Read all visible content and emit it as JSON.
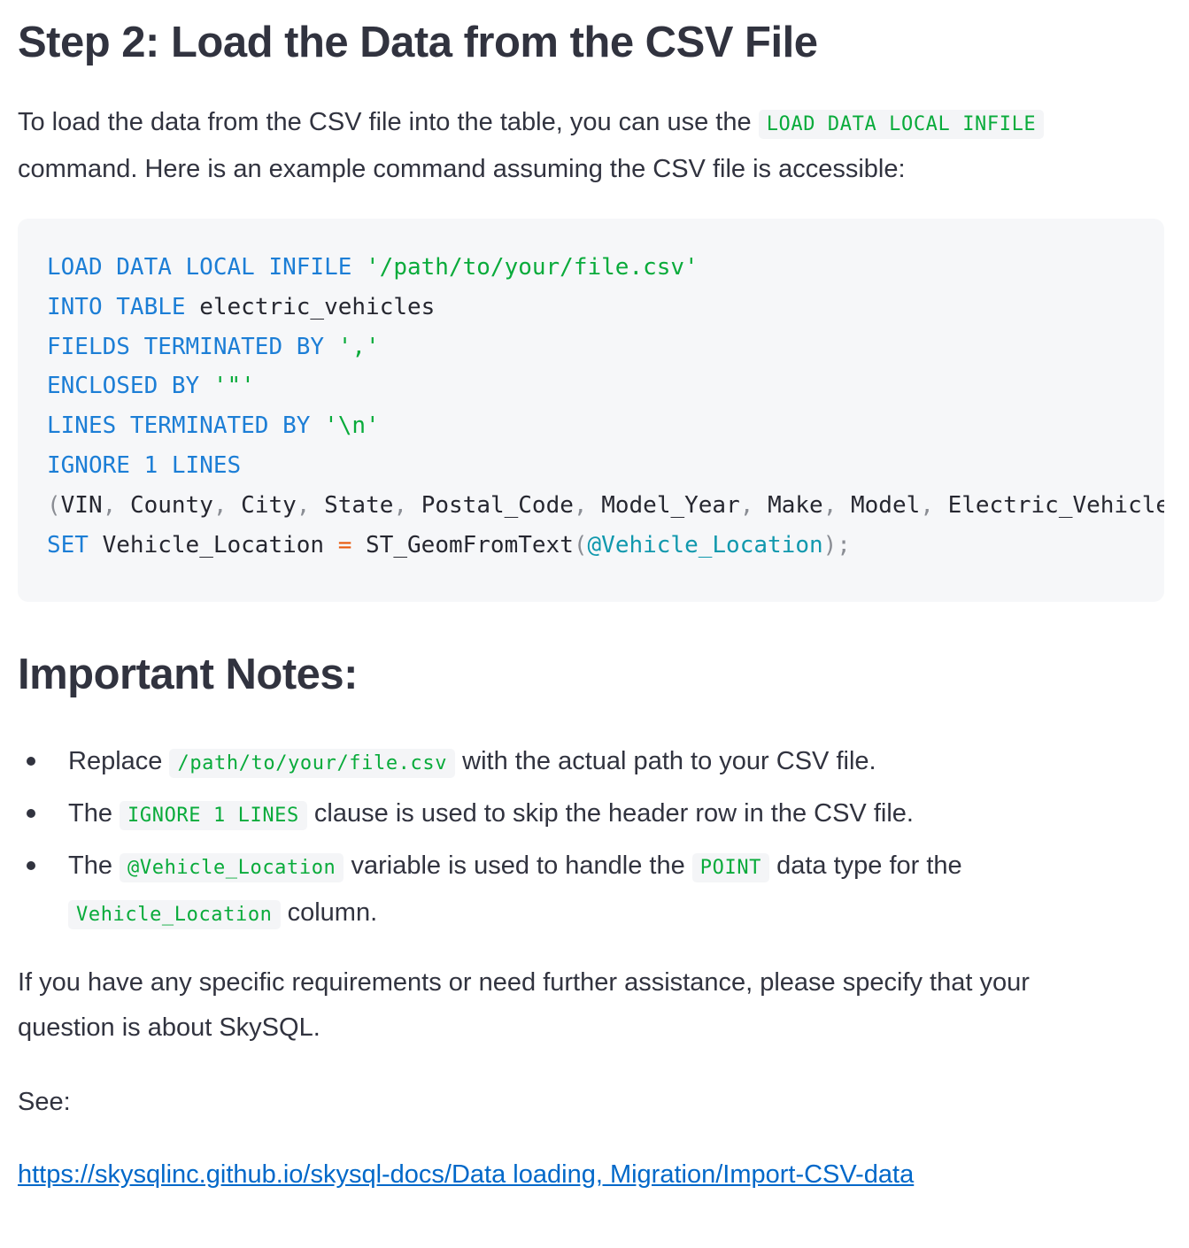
{
  "step_title": "Step 2: Load the Data from the CSV File",
  "intro": {
    "before": "To load the data from the CSV file into the table, you can use the ",
    "code": "LOAD DATA LOCAL INFILE",
    "after": " command. Here is an example command assuming the CSV file is accessible:"
  },
  "code_block": {
    "line1": {
      "kw": "LOAD DATA LOCAL INFILE",
      "str": "'/path/to/your/file.csv'"
    },
    "line2": {
      "kw": "INTO TABLE",
      "text": "electric_vehicles"
    },
    "line3": {
      "kw": "FIELDS TERMINATED BY",
      "str": "','"
    },
    "line4": {
      "kw": "ENCLOSED BY",
      "str": "'\"'"
    },
    "line5": {
      "kw": "LINES TERMINATED BY",
      "str": "'\\n'"
    },
    "line6": {
      "kw": "IGNORE",
      "num": "1",
      "kw2": "LINES"
    },
    "line7": {
      "open": "(",
      "cols": [
        "VIN",
        "County",
        "City",
        "State",
        "Postal_Code",
        "Model_Year",
        "Make",
        "Model",
        "Electric_Vehicle_Type"
      ],
      "sep": ", "
    },
    "line8": {
      "kw": "SET",
      "lhs": "Vehicle_Location",
      "op": "=",
      "fn": "ST_GeomFromText",
      "open": "(",
      "var": "@Vehicle_Location",
      "close": ")",
      "semi": ";"
    }
  },
  "notes_title": "Important Notes:",
  "notes": [
    {
      "before": "Replace ",
      "code": "/path/to/your/file.csv",
      "after": " with the actual path to your CSV file."
    },
    {
      "before": "The ",
      "code": "IGNORE 1 LINES",
      "after": " clause is used to skip the header row in the CSV file."
    },
    {
      "before": "The ",
      "code": "@Vehicle_Location",
      "middle": " variable is used to handle the ",
      "code2": "POINT",
      "middle2": " data type for the ",
      "code3": "Vehicle_Location",
      "after": " column."
    }
  ],
  "closing": "If you have any specific requirements or need further assistance, please specify that your question is about SkySQL.",
  "see_label": "See:",
  "link": {
    "text": "https://skysqlinc.github.io/skysql-docs/Data loading, Migration/Import-CSV-data"
  },
  "colors": {
    "text": "#31333f",
    "inline_code": "#09ab3b",
    "keyword": "#1c7ed6",
    "variable": "#1098ad",
    "link": "#0068c9",
    "code_bg": "#f6f7f9"
  }
}
